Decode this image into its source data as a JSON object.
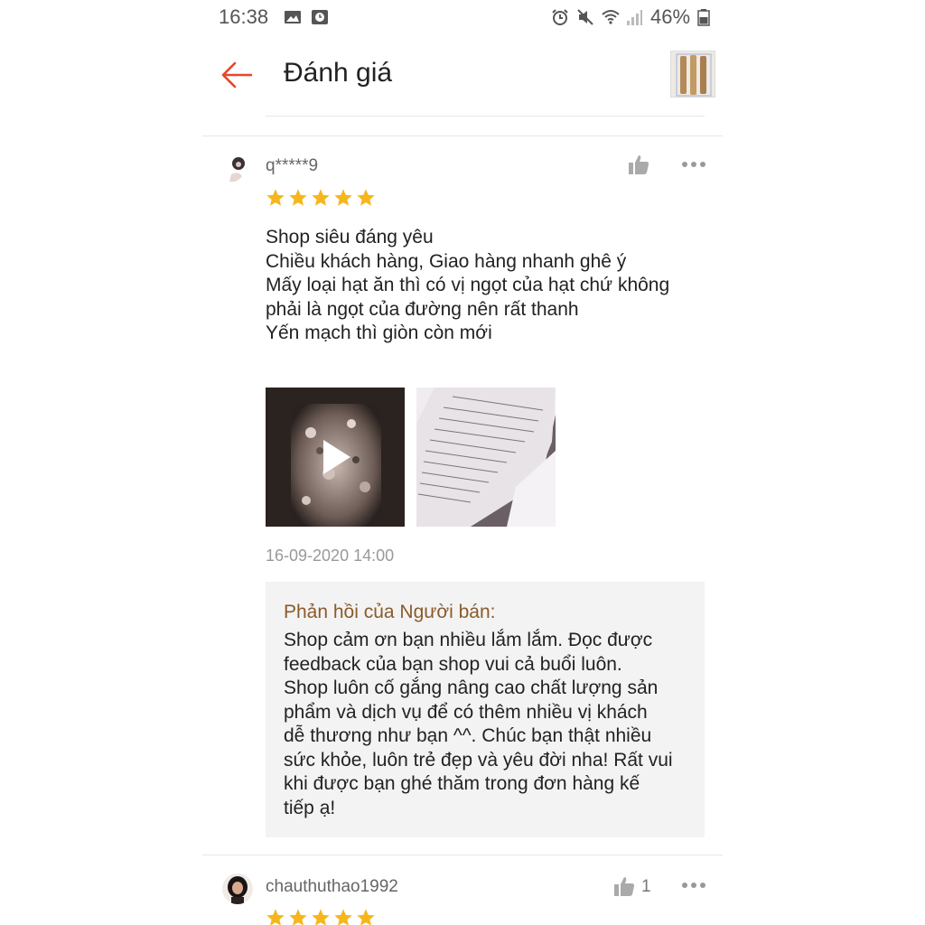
{
  "status_bar": {
    "time": "16:38",
    "battery": "46%",
    "icons": [
      "image-icon",
      "clock-icon",
      "alarm-icon",
      "mute-icon",
      "wifi-icon",
      "signal-icon",
      "battery-icon"
    ]
  },
  "header": {
    "title": "Đánh giá",
    "back_icon": "back-arrow-icon",
    "accent_color": "#e8452c"
  },
  "reviews": [
    {
      "username": "q*****9",
      "rating": 5,
      "text_lines": [
        "Shop siêu đáng yêu",
        "Chiều khách hàng, Giao hàng nhanh ghê ý",
        "Mấy loại hạt ăn thì có vị ngọt của hạt chứ không",
        "phải là ngọt của đường nên rất thanh",
        "Yến mạch thì giòn còn mới"
      ],
      "media": [
        {
          "type": "video",
          "icon": "play-icon"
        },
        {
          "type": "image"
        }
      ],
      "date": "16-09-2020 14:00",
      "seller_reply": {
        "title": "Phản hồi của Người bán:",
        "lines": [
          "Shop cảm ơn bạn nhiều lắm lắm. Đọc được",
          "feedback của bạn shop vui cả buổi luôn.",
          "Shop luôn cố gắng nâng cao chất lượng sản",
          "phẩm và dịch vụ để có thêm nhiều vị khách",
          "dễ thương như bạn ^^. Chúc bạn thật nhiều",
          "sức khỏe, luôn trẻ đẹp và yêu đời nha! Rất vui",
          "khi được bạn ghé thăm trong đơn hàng kế",
          "tiếp ạ!"
        ]
      }
    },
    {
      "username": "chauthuthao1992",
      "likes": "1",
      "rating": 5
    }
  ],
  "colors": {
    "star": "#f6b61c",
    "reply_title": "#8a5a2b",
    "reply_bg": "#f3f3f3"
  }
}
